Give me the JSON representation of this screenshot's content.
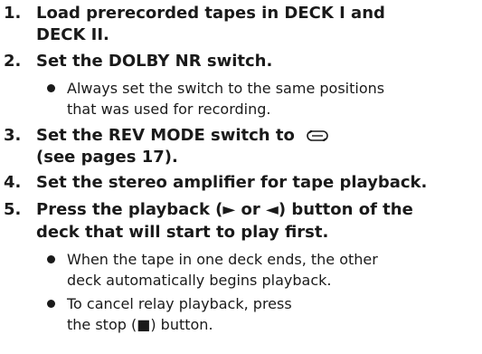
{
  "steps": [
    {
      "number": "1.",
      "lines": [
        "Load prerecorded tapes in DECK I and",
        "DECK II."
      ]
    },
    {
      "number": "2.",
      "lines": [
        "Set the DOLBY NR switch."
      ],
      "bullets": [
        {
          "lines": [
            "Always set the switch to the same positions",
            "that was used for recording."
          ]
        }
      ]
    },
    {
      "number": "3.",
      "lines": [
        "Set the REV MODE switch to",
        "(see pages 17)."
      ],
      "icon": "relay-mode-icon"
    },
    {
      "number": "4.",
      "lines": [
        "Set the stereo amplifier for tape playback."
      ]
    },
    {
      "number": "5.",
      "lines": [
        "Press the playback (► or ◄) button of the",
        "deck that will start to play first."
      ],
      "bullets": [
        {
          "lines": [
            "When the tape in one deck ends, the other",
            "deck automatically begins playback."
          ]
        },
        {
          "lines": [
            "To cancel relay playback, press",
            "the stop (■) button."
          ]
        }
      ]
    }
  ]
}
